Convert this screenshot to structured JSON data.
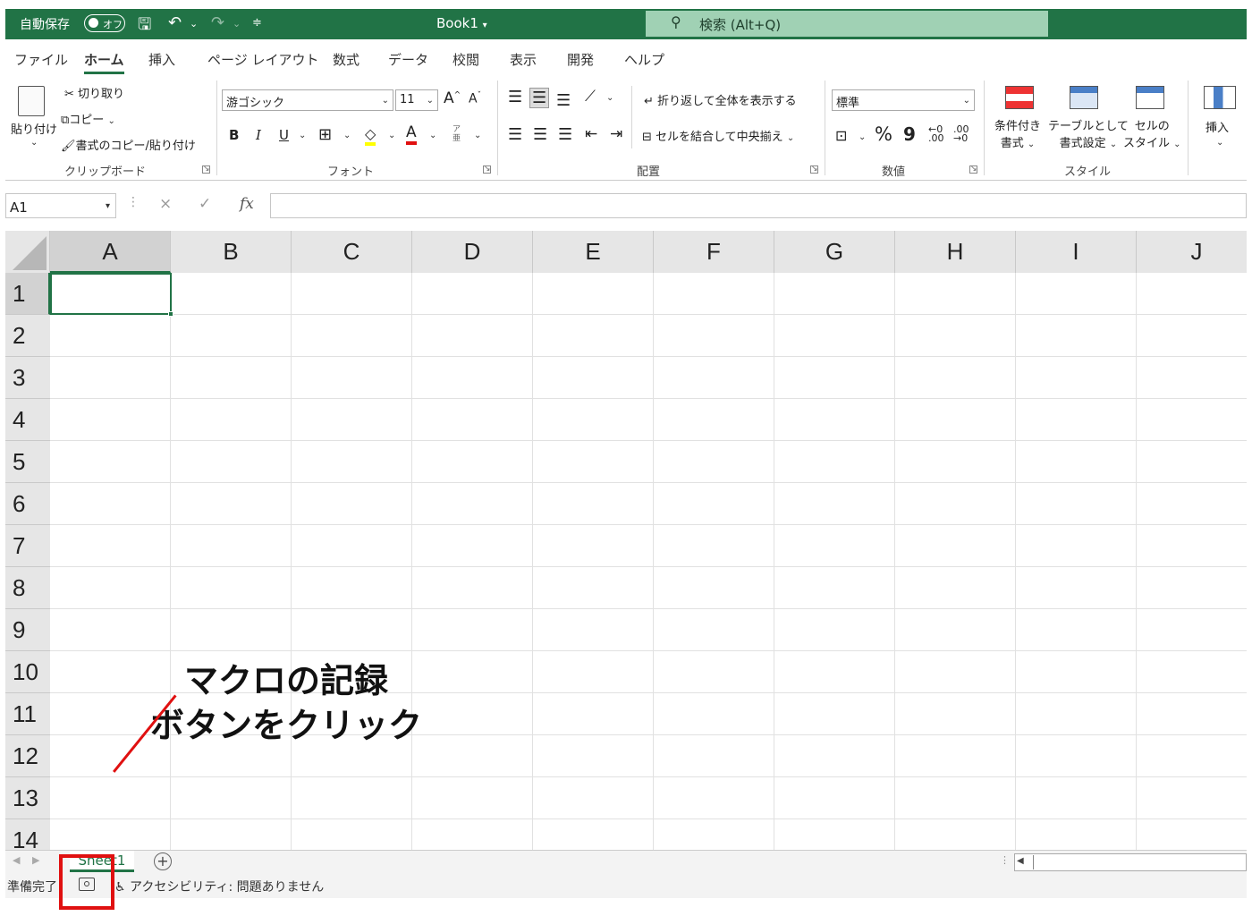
{
  "titlebar": {
    "autosave_label": "自動保存",
    "toggle_label": "オフ",
    "doc_title": "Book1",
    "search_placeholder": "検索 (Alt+Q)"
  },
  "menu": {
    "items": [
      "ファイル",
      "ホーム",
      "挿入",
      "ページ レイアウト",
      "数式",
      "データ",
      "校閲",
      "表示",
      "開発",
      "ヘルプ"
    ],
    "active": "ホーム"
  },
  "ribbon": {
    "clipboard": {
      "paste": "貼り付け",
      "cut": "切り取り",
      "copy": "コピー",
      "format_painter": "書式のコピー/貼り付け",
      "label": "クリップボード"
    },
    "font": {
      "name": "游ゴシック",
      "size": "11",
      "bold": "B",
      "italic": "I",
      "underline": "U",
      "label": "フォント",
      "grow": "A",
      "shrink": "A",
      "color_letter": "A",
      "phonetic": "ア亜"
    },
    "alignment": {
      "wrap": "折り返して全体を表示する",
      "merge": "セルを結合して中央揃え",
      "label": "配置"
    },
    "number": {
      "format": "標準",
      "percent": "%",
      "comma": "9",
      "label": "数値"
    },
    "styles": {
      "conditional_l1": "条件付き",
      "conditional_l2": "書式",
      "table_l1": "テーブルとして",
      "table_l2": "書式設定",
      "cell_l1": "セルの",
      "cell_l2": "スタイル",
      "label": "スタイル"
    },
    "cells": {
      "insert": "挿入"
    }
  },
  "formula_bar": {
    "name_box": "A1",
    "fx": "fx",
    "cancel": "×",
    "enter": "✓"
  },
  "grid": {
    "columns": [
      "A",
      "B",
      "C",
      "D",
      "E",
      "F",
      "G",
      "H",
      "I",
      "J"
    ],
    "rows": [
      "1",
      "2",
      "3",
      "4",
      "5",
      "6",
      "7",
      "8",
      "9",
      "10",
      "11",
      "12",
      "13",
      "14"
    ],
    "active_cell": "A1"
  },
  "sheets": {
    "tabs": [
      "Sheet1"
    ],
    "add_symbol": "+"
  },
  "status": {
    "ready": "準備完了",
    "accessibility": "アクセシビリティ: 問題ありません"
  },
  "annotation": {
    "line1": "マクロの記録",
    "line2": "ボタンをクリック",
    "color": "#e01010"
  },
  "colors": {
    "excel_green": "#217346",
    "search_bg": "#a0d1b4"
  }
}
